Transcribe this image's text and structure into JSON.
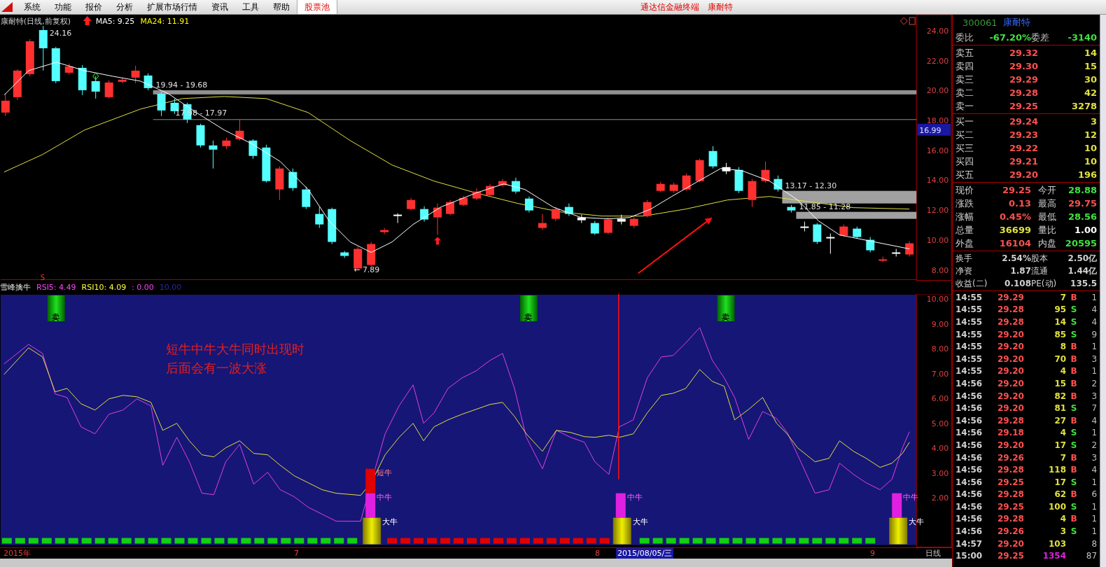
{
  "menu_bar": {
    "items": [
      {
        "label": "系统",
        "selected": false
      },
      {
        "label": "功能",
        "selected": false
      },
      {
        "label": "报价",
        "selected": false
      },
      {
        "label": "分析",
        "selected": false
      },
      {
        "label": "扩展市场行情",
        "selected": false
      },
      {
        "label": "资讯",
        "selected": false
      },
      {
        "label": "工具",
        "selected": false
      },
      {
        "label": "帮助",
        "selected": false
      },
      {
        "label": "股票池",
        "selected": true
      }
    ],
    "title_parts": [
      "通达信金融终端",
      "康耐特"
    ]
  },
  "main_chart": {
    "title": "康耐特(日线,前复权)",
    "indicators": [
      {
        "label": "MA5: 9.25",
        "color": "#ffffff"
      },
      {
        "label": "MA24: 11.91",
        "color": "#ffff00"
      }
    ],
    "labels": [
      "24.16",
      "19.94 - 19.68",
      "17.98 - 17.97",
      "13.17 - 12.30",
      "11.85 - 11.28",
      "← 7.89"
    ],
    "y_axis": [
      "24.00",
      "22.00",
      "20.00",
      "18.00",
      "16.00",
      "14.00",
      "12.00",
      "10.00",
      "8.00"
    ],
    "cursor_price": "16.99",
    "marker": "S"
  },
  "indicator_panel": {
    "name": "雪峰擒牛",
    "values": [
      {
        "text": "RSI5: 4.49",
        "color": "#ff40ff"
      },
      {
        "text": "RSI10: 4.09",
        "color": "#ffff40"
      },
      {
        "text": ": 0.00",
        "color": "#ff40ff"
      },
      {
        "text": "10.00",
        "color": "#2828a8"
      }
    ],
    "y_axis": [
      "10.00",
      "9.00",
      "8.00",
      "7.00",
      "6.00",
      "5.00",
      "4.00",
      "3.00",
      "2.00"
    ],
    "sell_signals": [
      "卖",
      "卖",
      "卖"
    ],
    "bull_signals": [
      {
        "kind": "short",
        "label": "短牛"
      },
      {
        "kind": "mid",
        "label": "中牛"
      },
      {
        "kind": "big",
        "label": "大牛"
      },
      {
        "kind": "mid",
        "label": "中牛"
      },
      {
        "kind": "big",
        "label": "大牛"
      },
      {
        "kind": "mid",
        "label": "中牛"
      },
      {
        "kind": "big",
        "label": "大牛"
      }
    ],
    "note": [
      "短牛中牛大牛同时出现时",
      "后面会有一波大涨"
    ]
  },
  "date_axis": [
    {
      "text": "2015年",
      "selected": false
    },
    {
      "text": "7",
      "selected": false
    },
    {
      "text": "8",
      "selected": false
    },
    {
      "text": "2015/08/05/三",
      "selected": true
    },
    {
      "text": "9",
      "selected": false
    }
  ],
  "period": "日线",
  "quote": {
    "code": "300061",
    "name": "康耐特",
    "ratio": [
      {
        "text": "委比",
        "color": "#c0c0c0"
      },
      {
        "text": "-67.20%",
        "color": "#40e040"
      },
      {
        "text": "委差",
        "color": "#c0c0c0"
      },
      {
        "text": "-3140",
        "color": "#40e040"
      }
    ],
    "sell": [
      {
        "label": "卖五",
        "price": "29.32",
        "volume": "14"
      },
      {
        "label": "卖四",
        "price": "29.30",
        "volume": "15"
      },
      {
        "label": "卖三",
        "price": "29.29",
        "volume": "30"
      },
      {
        "label": "卖二",
        "price": "29.28",
        "volume": "42"
      },
      {
        "label": "卖一",
        "price": "29.25",
        "volume": "3278"
      }
    ],
    "buy": [
      {
        "label": "买一",
        "price": "29.24",
        "volume": "3"
      },
      {
        "label": "买二",
        "price": "29.23",
        "volume": "12"
      },
      {
        "label": "买三",
        "price": "29.22",
        "volume": "10"
      },
      {
        "label": "买四",
        "price": "29.21",
        "volume": "10"
      },
      {
        "label": "买五",
        "price": "29.20",
        "volume": "196"
      }
    ],
    "stats": [
      {
        "label": "现价",
        "value": "29.25",
        "color": "#ff5050"
      },
      {
        "label": "今开",
        "value": "28.88",
        "color": "#40e040"
      },
      {
        "label": "涨跌",
        "value": "0.13",
        "color": "#ff5050"
      },
      {
        "label": "最高",
        "value": "29.75",
        "color": "#ff5050"
      },
      {
        "label": "涨幅",
        "value": "0.45%",
        "color": "#ff5050"
      },
      {
        "label": "最低",
        "value": "28.56",
        "color": "#40e040"
      },
      {
        "label": "总量",
        "value": "36699",
        "color": "#e0e040"
      },
      {
        "label": "量比",
        "value": "1.00",
        "color": "#ffffff"
      },
      {
        "label": "外盘",
        "value": "16104",
        "color": "#ff5050"
      },
      {
        "label": "内盘",
        "value": "20595",
        "color": "#40e040"
      }
    ],
    "info": [
      {
        "label": "换手",
        "value": "2.54%",
        "label2": "股本",
        "value2": "2.50亿"
      },
      {
        "label": "净资",
        "value": "1.87",
        "label2": "流通",
        "value2": "1.44亿"
      },
      {
        "label": "收益(二)",
        "value": "0.108",
        "label2": "PE(动)",
        "value2": "135.5"
      }
    ],
    "trades": [
      {
        "time": "14:55",
        "price": "29.29",
        "volume": "7",
        "side": "B",
        "count": "1",
        "large": false
      },
      {
        "time": "14:55",
        "price": "29.28",
        "volume": "95",
        "side": "S",
        "count": "4",
        "large": false
      },
      {
        "time": "14:55",
        "price": "29.28",
        "volume": "14",
        "side": "S",
        "count": "4",
        "large": false
      },
      {
        "time": "14:55",
        "price": "29.20",
        "volume": "85",
        "side": "S",
        "count": "9",
        "large": false
      },
      {
        "time": "14:55",
        "price": "29.20",
        "volume": "8",
        "side": "B",
        "count": "1",
        "large": false
      },
      {
        "time": "14:55",
        "price": "29.20",
        "volume": "70",
        "side": "B",
        "count": "3",
        "large": false
      },
      {
        "time": "14:55",
        "price": "29.20",
        "volume": "4",
        "side": "B",
        "count": "1",
        "large": false
      },
      {
        "time": "14:56",
        "price": "29.20",
        "volume": "15",
        "side": "B",
        "count": "2",
        "large": false
      },
      {
        "time": "14:56",
        "price": "29.20",
        "volume": "82",
        "side": "B",
        "count": "3",
        "large": false
      },
      {
        "time": "14:56",
        "price": "29.20",
        "volume": "81",
        "side": "S",
        "count": "7",
        "large": false
      },
      {
        "time": "14:56",
        "price": "29.28",
        "volume": "27",
        "side": "B",
        "count": "4",
        "large": false
      },
      {
        "time": "14:56",
        "price": "29.18",
        "volume": "4",
        "side": "S",
        "count": "1",
        "large": false
      },
      {
        "time": "14:56",
        "price": "29.20",
        "volume": "17",
        "side": "S",
        "count": "2",
        "large": false
      },
      {
        "time": "14:56",
        "price": "29.26",
        "volume": "7",
        "side": "B",
        "count": "3",
        "large": false
      },
      {
        "time": "14:56",
        "price": "29.28",
        "volume": "118",
        "side": "B",
        "count": "4",
        "large": false
      },
      {
        "time": "14:56",
        "price": "29.25",
        "volume": "17",
        "side": "S",
        "count": "1",
        "large": false
      },
      {
        "time": "14:56",
        "price": "29.28",
        "volume": "62",
        "side": "B",
        "count": "6",
        "large": false
      },
      {
        "time": "14:56",
        "price": "29.25",
        "volume": "100",
        "side": "S",
        "count": "1",
        "large": false
      },
      {
        "time": "14:56",
        "price": "29.28",
        "volume": "4",
        "side": "B",
        "count": "1",
        "large": false
      },
      {
        "time": "14:56",
        "price": "29.26",
        "volume": "3",
        "side": "S",
        "count": "1",
        "large": false
      },
      {
        "time": "14:57",
        "price": "29.20",
        "volume": "103",
        "count": "8",
        "large": false
      },
      {
        "time": "15:00",
        "price": "29.25",
        "volume": "1354",
        "count": "87",
        "large": true
      }
    ]
  }
}
